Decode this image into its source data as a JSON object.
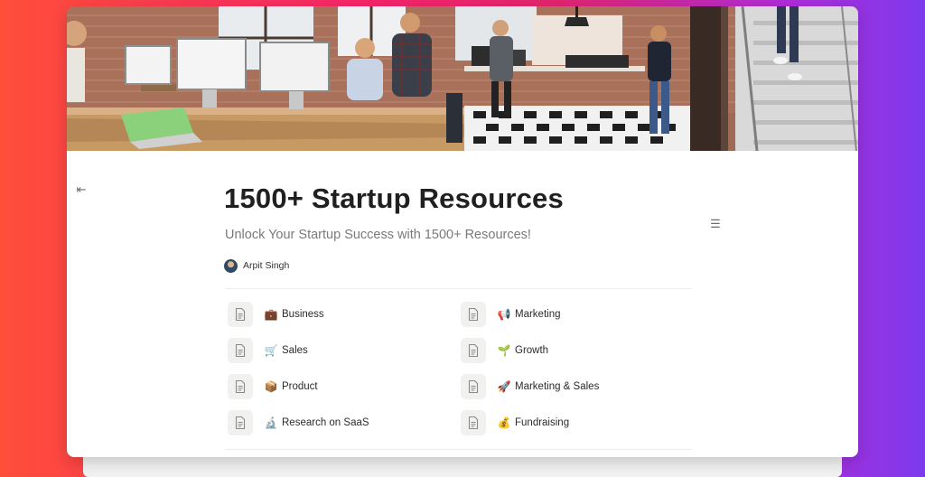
{
  "page": {
    "title": "1500+ Startup Resources",
    "subtitle": "Unlock Your Startup Success with 1500+ Resources!"
  },
  "author": {
    "name": "Arpit Singh"
  },
  "icons": {
    "collapse": "collapse-sidebar-icon",
    "toc": "table-of-contents-icon",
    "page": "document-icon"
  },
  "links": [
    {
      "emoji": "💼",
      "label": "Business"
    },
    {
      "emoji": "📢",
      "label": "Marketing"
    },
    {
      "emoji": "🛒",
      "label": "Sales"
    },
    {
      "emoji": "🌱",
      "label": "Growth"
    },
    {
      "emoji": "📦",
      "label": "Product"
    },
    {
      "emoji": "🚀",
      "label": "Marketing & Sales"
    },
    {
      "emoji": "🔬",
      "label": "Research on SaaS"
    },
    {
      "emoji": "💰",
      "label": "Fundraising"
    }
  ],
  "colors": {
    "background_start": "#ff4e3a",
    "background_end": "#7c3aed",
    "title": "#202020",
    "subtitle": "#7a7a7a"
  }
}
